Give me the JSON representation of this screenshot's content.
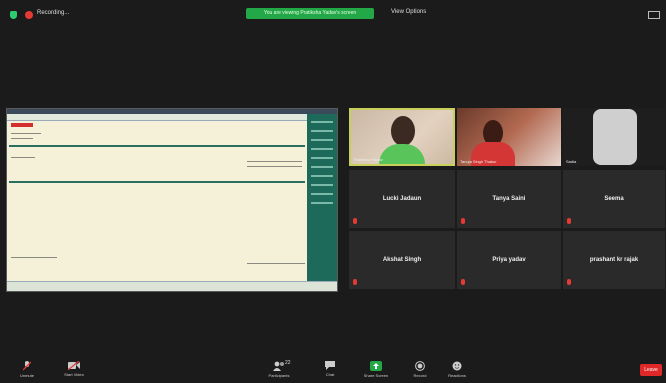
{
  "header": {
    "recording_label": "Recording...",
    "share_banner": "You are viewing Pratiksha Yadav's screen",
    "view_options": "View Options"
  },
  "participants": [
    {
      "name": "Pratiksha Yadav",
      "video": true
    },
    {
      "name": "Tanuja Singh Thakur",
      "video": true
    },
    {
      "name": "Sadia",
      "video": true
    },
    {
      "name": "Lucki Jadaun",
      "video": false
    },
    {
      "name": "Tanya Saini",
      "video": false
    },
    {
      "name": "Seema",
      "video": false
    },
    {
      "name": "Akshat Singh",
      "video": false
    },
    {
      "name": "Priya yadav",
      "video": false
    },
    {
      "name": "prashant kr rajak",
      "video": false
    }
  ],
  "toolbar": {
    "unmute": "Unmute",
    "start_video": "Start Video",
    "participants_label": "Participants",
    "participants_count": "22",
    "chat": "Chat",
    "share_screen": "Share Screen",
    "record": "Record",
    "reactions": "Reactions",
    "end": "Leave"
  }
}
